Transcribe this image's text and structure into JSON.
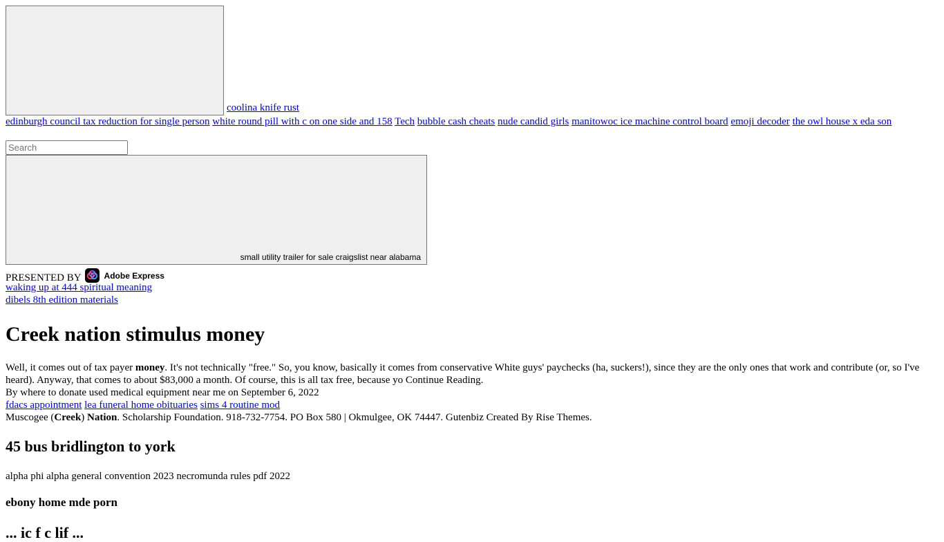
{
  "top_image_label": "",
  "top_link": "coolina knife rust",
  "nav_links": [
    "edinburgh council tax reduction for single person",
    "white round pill with c on one side and 158",
    "Tech",
    "bubble cash cheats",
    "nude candid girls",
    "manitowoc ice machine control board",
    "emoji decoder",
    "the owl house x eda son"
  ],
  "search": {
    "placeholder": "Search"
  },
  "ad": {
    "caption": "small utility trailer for sale craigslist near alabama",
    "presented_by": "PRESENTED BY",
    "brand": "Adobe Express"
  },
  "side_links": [
    "waking up at 444 spiritual meaning",
    "dibels 8th edition materials"
  ],
  "article": {
    "title": "Creek nation stimulus money",
    "p1_before": "Well, it comes out of tax payer ",
    "p1_bold": "money",
    "p1_after": ". It's not technically \"free.\" So, you know, basically it comes from conservative White guys' paychecks (ha, suckers!), since they are the only ones that work and contribute (or, so I've heard). Anyway, that comes to about $83,000 a month. Of course, this is all tax free, because yo Continue Reading.",
    "byline": "By where to donate used medical equipment near me  on September 6, 2022",
    "tag_links": [
      "fdacs appointment",
      "lea funeral home obituaries",
      "sims 4 routine mod"
    ],
    "footer_pre": "Muscogee (",
    "footer_b1": "Creek",
    "footer_mid": ") ",
    "footer_b2": "Nation",
    "footer_post": ". Scholarship Foundation. 918-732-7754. PO Box 580 | Okmulgee, OK 74447. Gutenbiz Created By Rise Themes.",
    "h2": "45 bus bridlington to york",
    "p2": "alpha phi alpha general convention 2023 necromunda rules pdf 2022",
    "h3": "ebony home mde porn",
    "h3b": "... ic f c lif ..."
  }
}
